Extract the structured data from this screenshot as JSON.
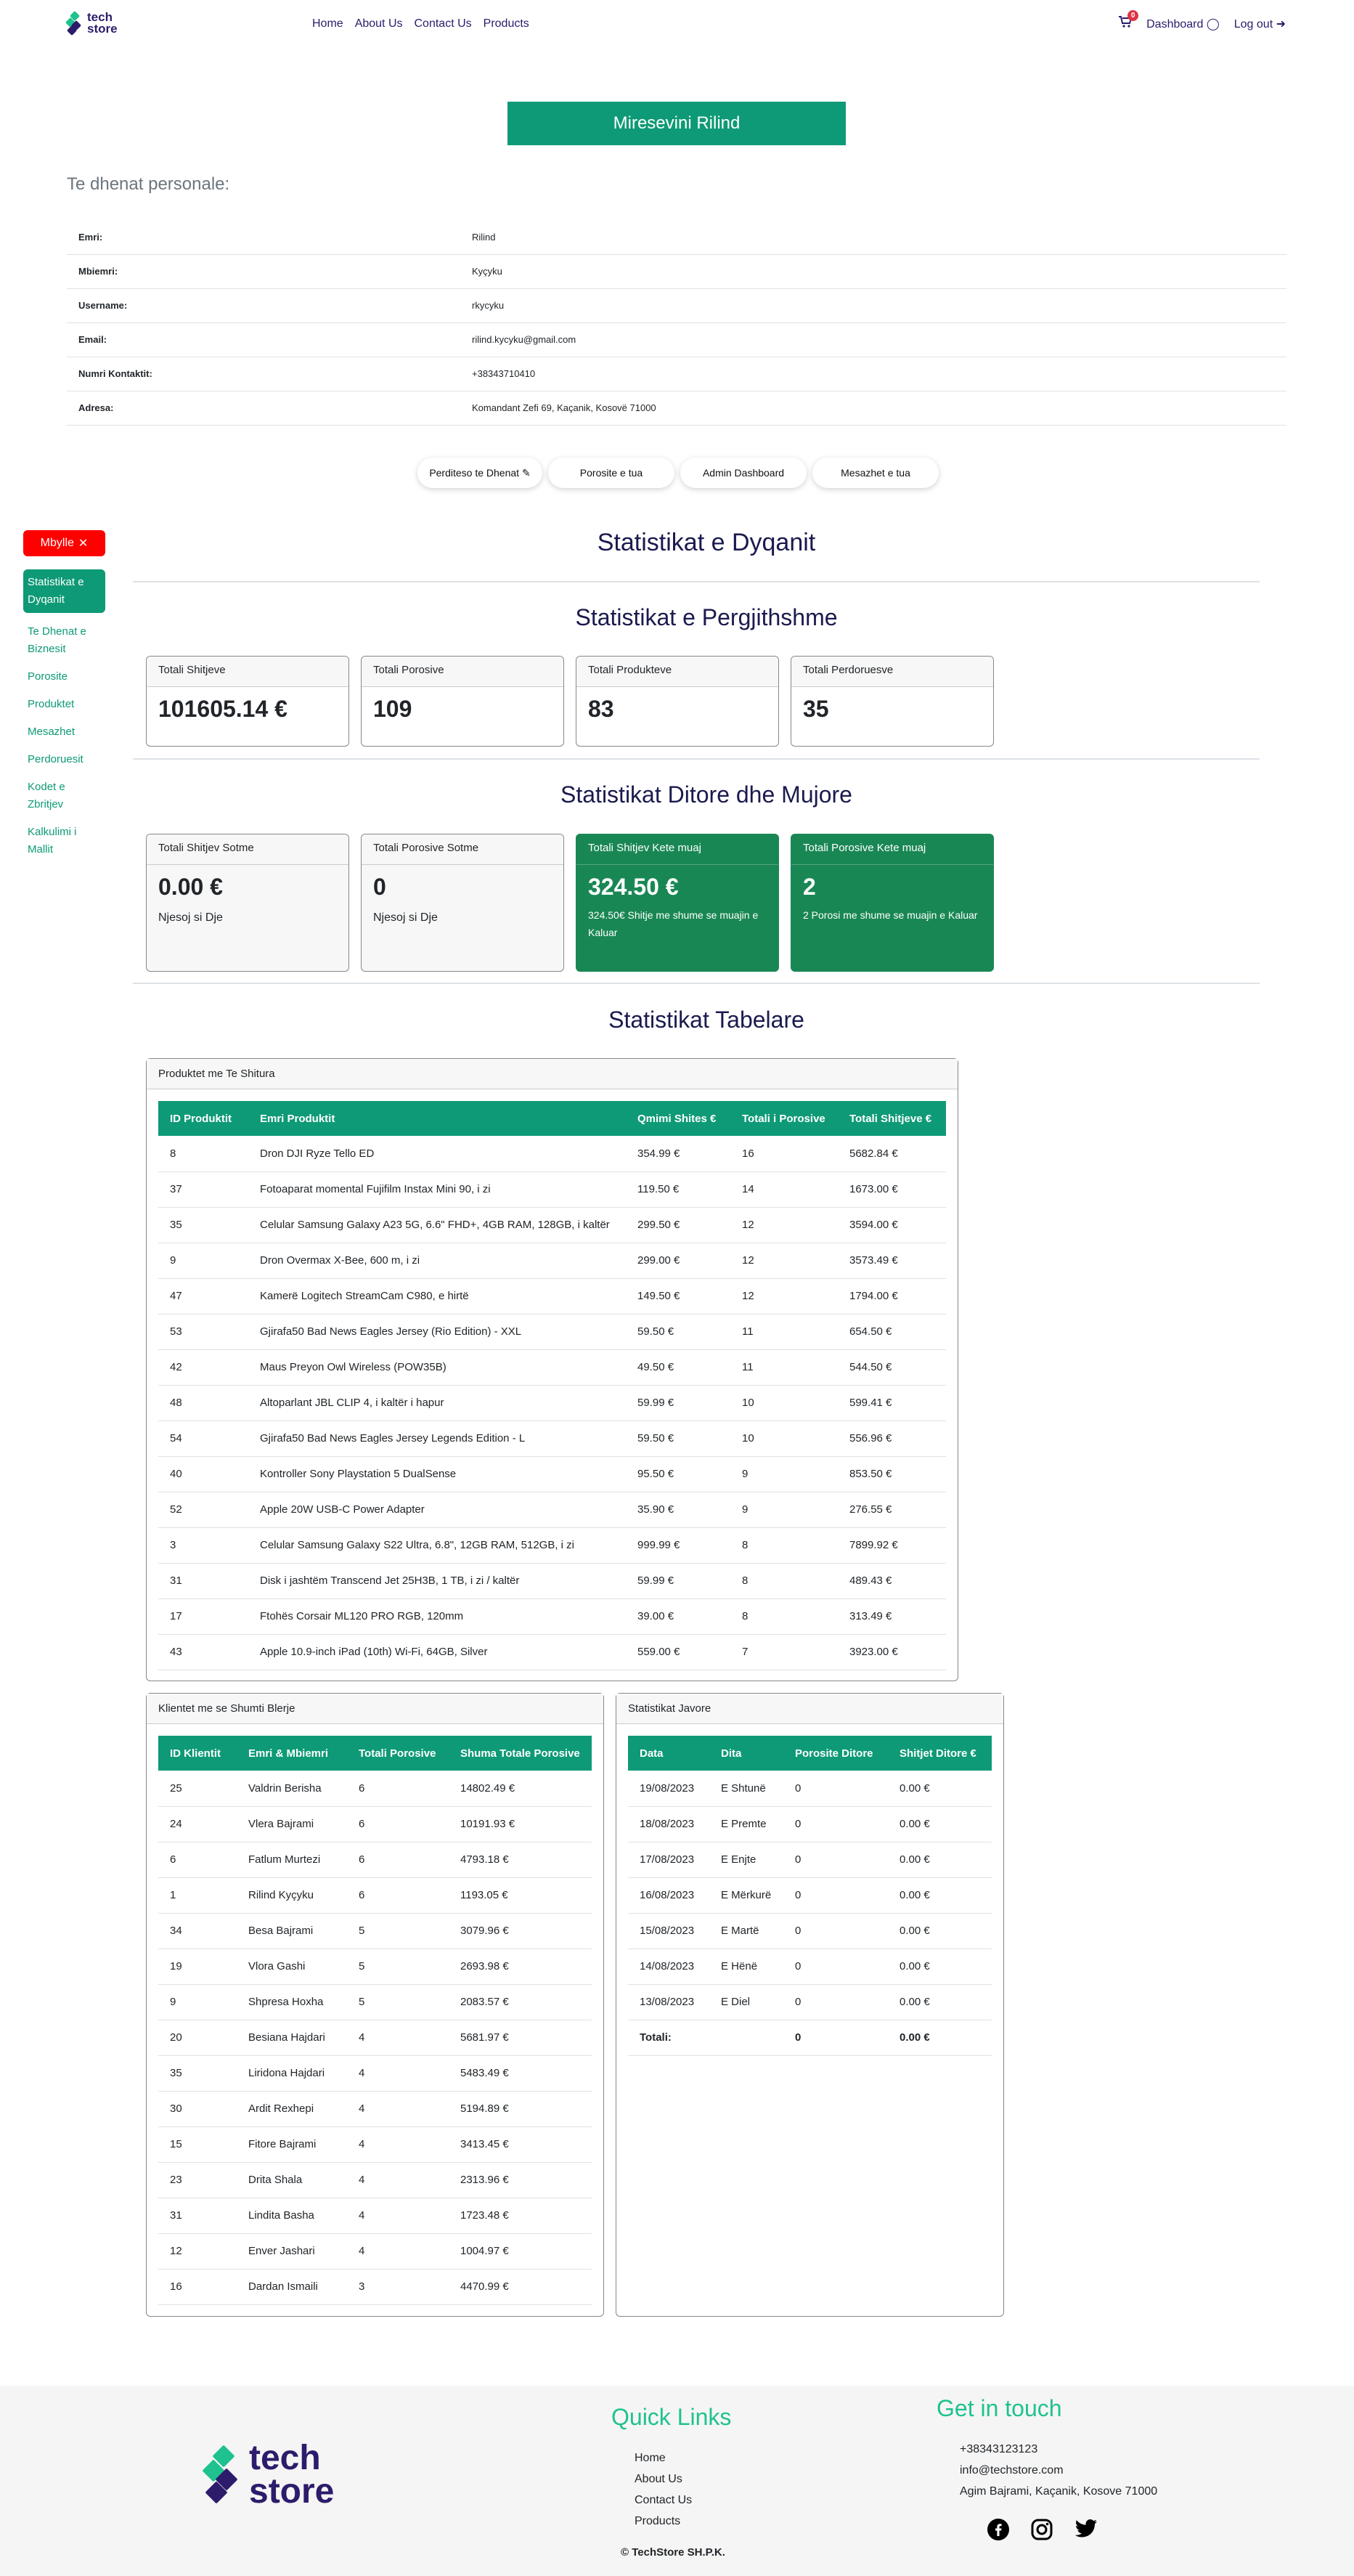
{
  "nav": {
    "brand_line1": "tech",
    "brand_line2": "store",
    "links": [
      "Home",
      "About Us",
      "Contact Us",
      "Products"
    ],
    "cart_count": "0",
    "dashboard": "Dashboard",
    "logout": "Log out"
  },
  "welcome": "Miresevini Rilind",
  "personal": {
    "heading": "Te dhenat personale:",
    "rows": [
      {
        "label": "Emri:",
        "value": "Rilind"
      },
      {
        "label": "Mbiemri:",
        "value": "Kyçyku"
      },
      {
        "label": "Username:",
        "value": "rkycyku"
      },
      {
        "label": "Email:",
        "value": "rilind.kycyku@gmail.com"
      },
      {
        "label": "Numri Kontaktit:",
        "value": "+38343710410"
      },
      {
        "label": "Adresa:",
        "value": "Komandant Zefi 69, Kaçanik, Kosovë 71000"
      }
    ]
  },
  "actions": [
    "Perditeso te Dhenat",
    "Porosite e tua",
    "Admin Dashboard",
    "Mesazhet e tua"
  ],
  "sidebar": {
    "close": "Mbylle",
    "items": [
      "Statistikat e Dyqanit",
      "Te Dhenat e Biznesit",
      "Porosite",
      "Produktet",
      "Mesazhet",
      "Perdoruesit",
      "Kodet e Zbritjev",
      "Kalkulimi i Mallit"
    ]
  },
  "stats": {
    "title": "Statistikat e Dyqanit",
    "general_title": "Statistikat e Pergjithshme",
    "general": [
      {
        "label": "Totali Shitjeve",
        "value": "101605.14 €"
      },
      {
        "label": "Totali Porosive",
        "value": "109"
      },
      {
        "label": "Totali Produkteve",
        "value": "83"
      },
      {
        "label": "Totali Perdoruesve",
        "value": "35"
      }
    ],
    "daily_title": "Statistikat Ditore dhe Mujore",
    "daily": [
      {
        "label": "Totali Shitjev Sotme",
        "value": "0.00 €",
        "sub": "Njesoj si Dje"
      },
      {
        "label": "Totali Porosive Sotme",
        "value": "0",
        "sub": "Njesoj si Dje"
      },
      {
        "label": "Totali Shitjev Kete muaj",
        "value": "324.50 €",
        "sub": "324.50€ Shitje me shume se muajin e Kaluar"
      },
      {
        "label": "Totali Porosive Kete muaj",
        "value": "2",
        "sub": "2 Porosi me shume se muajin e Kaluar"
      }
    ],
    "table_title": "Statistikat Tabelare"
  },
  "products": {
    "title": "Produktet me Te Shitura",
    "headers": [
      "ID Produktit",
      "Emri Produktit",
      "Qmimi Shites €",
      "Totali i Porosive",
      "Totali Shitjeve €"
    ],
    "rows": [
      [
        "8",
        "Dron DJI Ryze Tello ED",
        "354.99 €",
        "16",
        "5682.84 €"
      ],
      [
        "37",
        "Fotoaparat momental Fujifilm Instax Mini 90, i zi",
        "119.50 €",
        "14",
        "1673.00 €"
      ],
      [
        "35",
        "Celular Samsung Galaxy A23 5G, 6.6\" FHD+, 4GB RAM, 128GB, i kaltër",
        "299.50 €",
        "12",
        "3594.00 €"
      ],
      [
        "9",
        "Dron Overmax X-Bee, 600 m, i zi",
        "299.00 €",
        "12",
        "3573.49 €"
      ],
      [
        "47",
        "Kamerë Logitech StreamCam C980, e hirtë",
        "149.50 €",
        "12",
        "1794.00 €"
      ],
      [
        "53",
        "Gjirafa50 Bad News Eagles Jersey (Rio Edition) - XXL",
        "59.50 €",
        "11",
        "654.50 €"
      ],
      [
        "42",
        "Maus Preyon Owl Wireless (POW35B)",
        "49.50 €",
        "11",
        "544.50 €"
      ],
      [
        "48",
        "Altoparlant JBL CLIP 4, i kaltër i hapur",
        "59.99 €",
        "10",
        "599.41 €"
      ],
      [
        "54",
        "Gjirafa50 Bad News Eagles Jersey Legends Edition - L",
        "59.50 €",
        "10",
        "556.96 €"
      ],
      [
        "40",
        "Kontroller Sony Playstation 5 DualSense",
        "95.50 €",
        "9",
        "853.50 €"
      ],
      [
        "52",
        "Apple 20W USB-C Power Adapter",
        "35.90 €",
        "9",
        "276.55 €"
      ],
      [
        "3",
        "Celular Samsung Galaxy S22 Ultra, 6.8\", 12GB RAM, 512GB, i zi",
        "999.99 €",
        "8",
        "7899.92 €"
      ],
      [
        "31",
        "Disk i jashtëm Transcend Jet 25H3B, 1 TB, i zi / kaltër",
        "59.99 €",
        "8",
        "489.43 €"
      ],
      [
        "17",
        "Ftohës Corsair ML120 PRO RGB, 120mm",
        "39.00 €",
        "8",
        "313.49 €"
      ],
      [
        "43",
        "Apple 10.9-inch iPad (10th) Wi-Fi, 64GB, Silver",
        "559.00 €",
        "7",
        "3923.00 €"
      ]
    ]
  },
  "clients": {
    "title": "Klientet me se Shumti Blerje",
    "headers": [
      "ID Klientit",
      "Emri & Mbiemri",
      "Totali Porosive",
      "Shuma Totale Porosive"
    ],
    "rows": [
      [
        "25",
        "Valdrin Berisha",
        "6",
        "14802.49 €"
      ],
      [
        "24",
        "Vlera Bajrami",
        "6",
        "10191.93 €"
      ],
      [
        "6",
        "Fatlum Murtezi",
        "6",
        "4793.18 €"
      ],
      [
        "1",
        "Rilind Kyçyku",
        "6",
        "1193.05 €"
      ],
      [
        "34",
        "Besa Bajrami",
        "5",
        "3079.96 €"
      ],
      [
        "19",
        "Vlora Gashi",
        "5",
        "2693.98 €"
      ],
      [
        "9",
        "Shpresa Hoxha",
        "5",
        "2083.57 €"
      ],
      [
        "20",
        "Besiana Hajdari",
        "4",
        "5681.97 €"
      ],
      [
        "35",
        "Liridona Hajdari",
        "4",
        "5483.49 €"
      ],
      [
        "30",
        "Ardit Rexhepi",
        "4",
        "5194.89 €"
      ],
      [
        "15",
        "Fitore Bajrami",
        "4",
        "3413.45 €"
      ],
      [
        "23",
        "Drita Shala",
        "4",
        "2313.96 €"
      ],
      [
        "31",
        "Lindita Basha",
        "4",
        "1723.48 €"
      ],
      [
        "12",
        "Enver Jashari",
        "4",
        "1004.97 €"
      ],
      [
        "16",
        "Dardan Ismaili",
        "3",
        "4470.99 €"
      ]
    ]
  },
  "weekly": {
    "title": "Statistikat Javore",
    "headers": [
      "Data",
      "Dita",
      "Porosite Ditore",
      "Shitjet Ditore €"
    ],
    "rows": [
      [
        "19/08/2023",
        "E Shtunë",
        "0",
        "0.00 €"
      ],
      [
        "18/08/2023",
        "E Premte",
        "0",
        "0.00 €"
      ],
      [
        "17/08/2023",
        "E Enjte",
        "0",
        "0.00 €"
      ],
      [
        "16/08/2023",
        "E Mërkurë",
        "0",
        "0.00 €"
      ],
      [
        "15/08/2023",
        "E Martë",
        "0",
        "0.00 €"
      ],
      [
        "14/08/2023",
        "E Hënë",
        "0",
        "0.00 €"
      ],
      [
        "13/08/2023",
        "E Diel",
        "0",
        "0.00 €"
      ]
    ],
    "total": [
      "Totali:",
      "",
      "0",
      "0.00 €"
    ]
  },
  "footer": {
    "brand_line1": "tech",
    "brand_line2": "store",
    "quick_title": "Quick Links",
    "links": [
      "Home",
      "About Us",
      "Contact Us",
      "Products"
    ],
    "contact_title": "Get in touch",
    "phone": "+38343123123",
    "email": "info@techstore.com",
    "address": "Agim Bajrami, Kaçanik, Kosove 71000",
    "copyright": "© TechStore SH.P.K."
  },
  "colors": {
    "brand_green": "#0e9a76",
    "accent_green": "#198754",
    "close_red": "#ff0000",
    "brand_navy": "#2d1c6b"
  }
}
